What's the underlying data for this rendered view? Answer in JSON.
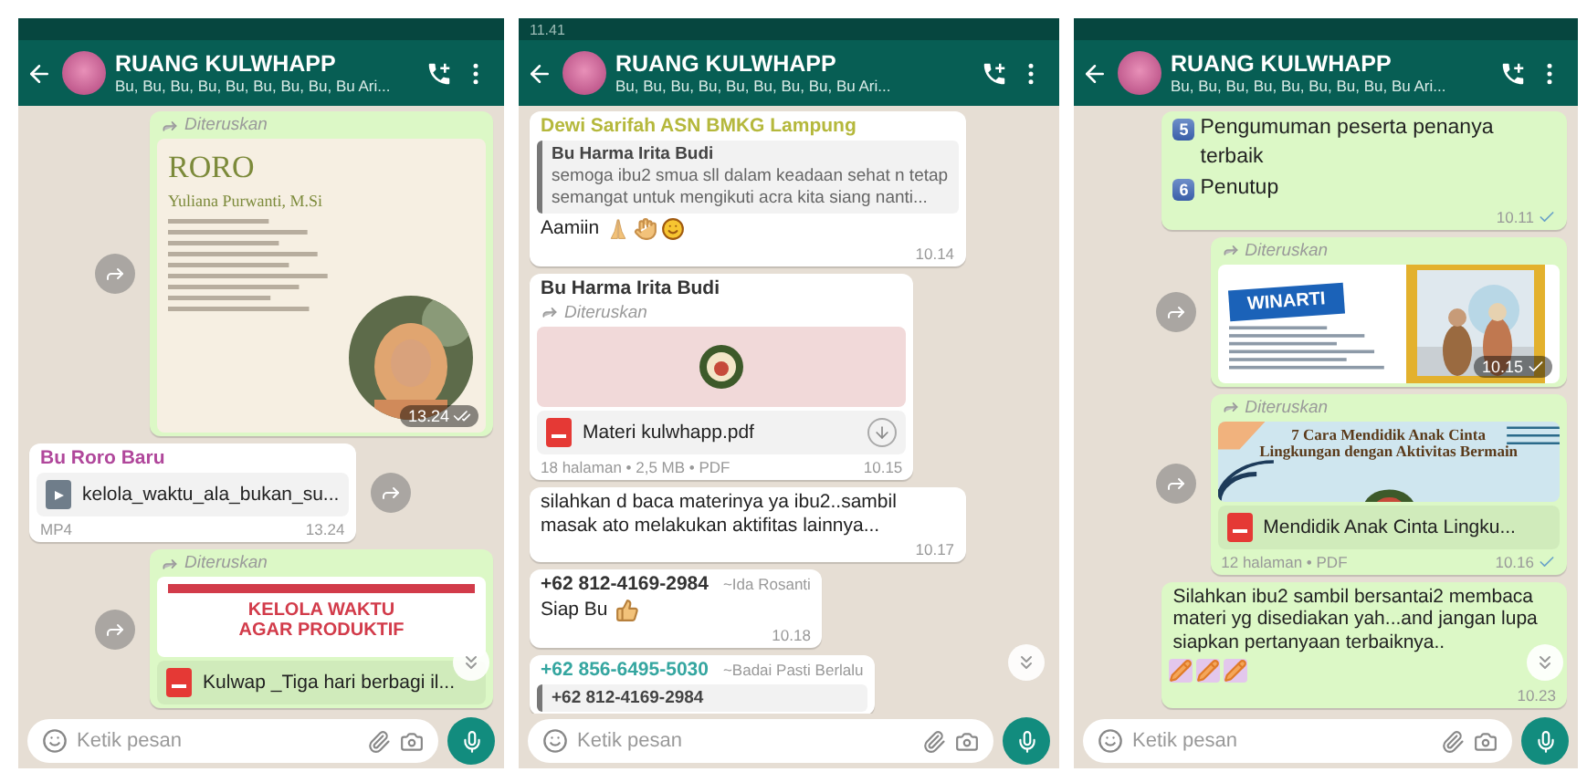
{
  "panels": [
    {
      "header": {
        "title": "RUANG KULWHAPP",
        "subtitle": "Bu, Bu, Bu, Bu, Bu, Bu, Bu, Bu, Bu Ari..."
      },
      "messages": [
        {
          "outgoing": true,
          "share_button": true,
          "forwarded_label": "Diteruskan",
          "preview": {
            "kind": "name-card",
            "title": "RORO",
            "subtitle": "Yuliana Purwanti, M.Si"
          },
          "time": "13.24",
          "read": true
        },
        {
          "outgoing": false,
          "share_button": true,
          "sender": "Bu Roro Baru",
          "color": "#b0479b",
          "file": {
            "kind": "video",
            "name": "kelola_waktu_ala_bukan_su..."
          },
          "meta": "MP4",
          "time": "13.24"
        },
        {
          "outgoing": true,
          "share_button": true,
          "forwarded_label": "Diteruskan",
          "preview": {
            "kind": "banner",
            "title": "KELOLA WAKTU AGAR PRODUKTIF"
          },
          "file": {
            "kind": "pdf",
            "name": "Kulwap _Tiga hari berbagi il..."
          }
        }
      ],
      "input": {
        "placeholder": "Ketik pesan"
      }
    },
    {
      "status_time": "11.41",
      "header": {
        "title": "RUANG KULWHAPP",
        "subtitle": "Bu, Bu, Bu, Bu, Bu, Bu, Bu, Bu, Bu Ari..."
      },
      "messages": [
        {
          "outgoing": false,
          "share_button": false,
          "sender": "Dewi Sarifah ASN BMKG Lampung",
          "color": "#b5b83c",
          "quote": {
            "author": "Bu Harma Irita Budi",
            "text": "semoga ibu2 smua sll dalam keadaan sehat n tetap semangat untuk mengikuti acra kita siang nanti..."
          },
          "text": "Aamiin",
          "emoji": [
            {
              "kind": "pray"
            },
            {
              "kind": "open-hands"
            },
            {
              "kind": "smile"
            }
          ],
          "time": "10.14"
        },
        {
          "outgoing": false,
          "share_button": false,
          "sender": "Bu Harma Irita Budi",
          "color": "#333333",
          "forwarded_label": "Diteruskan",
          "preview": {
            "kind": "logo-doc"
          },
          "file": {
            "kind": "pdf",
            "name": "Materi kulwhapp.pdf",
            "download": true
          },
          "meta": "18 halaman • 2,5 MB • PDF",
          "time": "10.15"
        },
        {
          "outgoing": false,
          "share_button": false,
          "text": "silahkan d baca materinya ya ibu2..sambil masak ato melakukan aktifitas lainnya...",
          "time": "10.17"
        },
        {
          "outgoing": false,
          "share_button": false,
          "sender": "+62 812-4169-2984",
          "color": "#333333",
          "pushname": "~Ida Rosanti",
          "text": "Siap Bu",
          "emoji": [
            {
              "kind": "thumbs-up"
            }
          ],
          "time": "10.18"
        },
        {
          "outgoing": false,
          "share_button": false,
          "sender": "+62 856-6495-5030",
          "color": "#35a6a0",
          "pushname": "~Badai Pasti Berlalu",
          "quote": {
            "author": "+62 812-4169-2984"
          }
        }
      ],
      "input": {
        "placeholder": "Ketik pesan"
      }
    },
    {
      "header": {
        "title": "RUANG KULWHAPP",
        "subtitle": "Bu, Bu, Bu, Bu, Bu, Bu, Bu, Bu, Bu Ari..."
      },
      "messages": [
        {
          "outgoing": true,
          "share_button": false,
          "list": [
            {
              "number": "5",
              "text": "Pengumuman peserta penanya terbaik"
            },
            {
              "number": "6",
              "text": "Penutup"
            }
          ],
          "time": "10.11",
          "read": false
        },
        {
          "outgoing": true,
          "share_button": true,
          "forwarded_label": "Diteruskan",
          "preview": {
            "kind": "badge-card",
            "title": "WINARTI"
          },
          "time": "10.15",
          "read": false
        },
        {
          "outgoing": true,
          "share_button": true,
          "forwarded_label": "Diteruskan",
          "preview": {
            "kind": "poster",
            "title": "7 Cara Mendidik Anak Cinta Lingkungan dengan Aktivitas Bermain"
          },
          "file": {
            "kind": "pdf",
            "name": "Mendidik Anak Cinta Lingku..."
          },
          "meta": "12 halaman • PDF",
          "time": "10.16",
          "read": false
        },
        {
          "outgoing": true,
          "share_button": false,
          "text": "Silahkan ibu2 sambil bersantai2 membaca materi yg disediakan yah...and jangan lupa siapkan pertanyaan terbaiknya..",
          "emoji": [
            {
              "kind": "pencil"
            },
            {
              "kind": "pencil"
            },
            {
              "kind": "pencil"
            }
          ],
          "time": "10.23"
        }
      ],
      "input": {
        "placeholder": "Ketik pesan"
      }
    }
  ]
}
